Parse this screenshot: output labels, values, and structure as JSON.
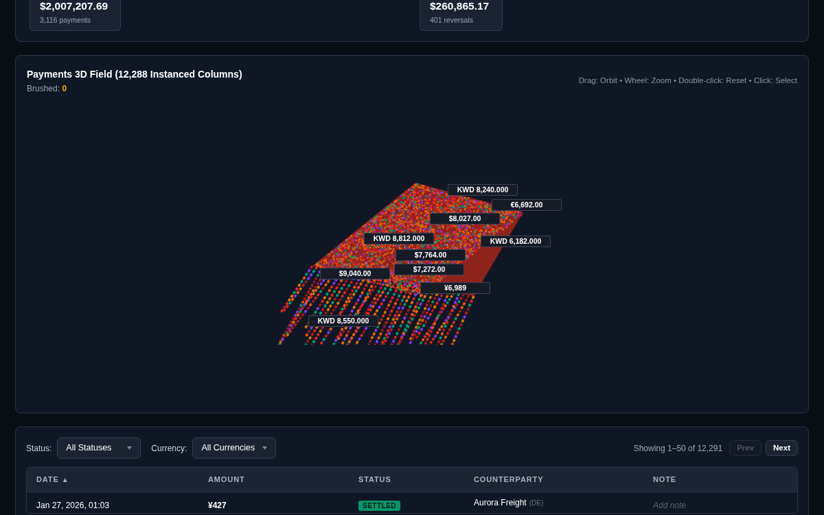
{
  "summary_cards": [
    {
      "value": "$2,007,207.69",
      "caption": "3,116 payments"
    },
    {
      "value": "$260,865.17",
      "caption": "401 reversals"
    }
  ],
  "field_panel": {
    "title": "Payments 3D Field (12,288 Instanced Columns)",
    "brushed_label": "Brushed:",
    "brushed_count": "0",
    "hint": "Drag: Orbit • Wheel: Zoom • Double-click: Reset • Click: Select",
    "labels": [
      "KWD 8,240.000",
      "€6,692.00",
      "$8,027.00",
      "KWD 8,812.000",
      "KWD 6,182.000",
      "$7,764.00",
      "$7,272.00",
      "$9,040.00",
      "¥6,989",
      "KWD 8,550.000"
    ]
  },
  "table_panel": {
    "filters": [
      {
        "label": "Status:",
        "value": "All Statuses"
      },
      {
        "label": "Currency:",
        "value": "All Currencies"
      }
    ],
    "showing": "Showing 1–50 of 12,291",
    "pager": [
      {
        "label": "Prev",
        "disabled": true
      },
      {
        "label": "Next",
        "disabled": false
      }
    ],
    "columns": [
      {
        "label": "DATE",
        "sort_icon": "▲"
      },
      {
        "label": "AMOUNT"
      },
      {
        "label": "STATUS"
      },
      {
        "label": "COUNTERPARTY"
      },
      {
        "label": "NOTE"
      }
    ],
    "rows": [
      {
        "date": "Jan 27, 2026, 01:03",
        "amount": "¥427",
        "status": "SETTLED",
        "counterparty": "Aurora Freight",
        "country": "(DE)",
        "note_placeholder": "Add note"
      }
    ]
  }
}
